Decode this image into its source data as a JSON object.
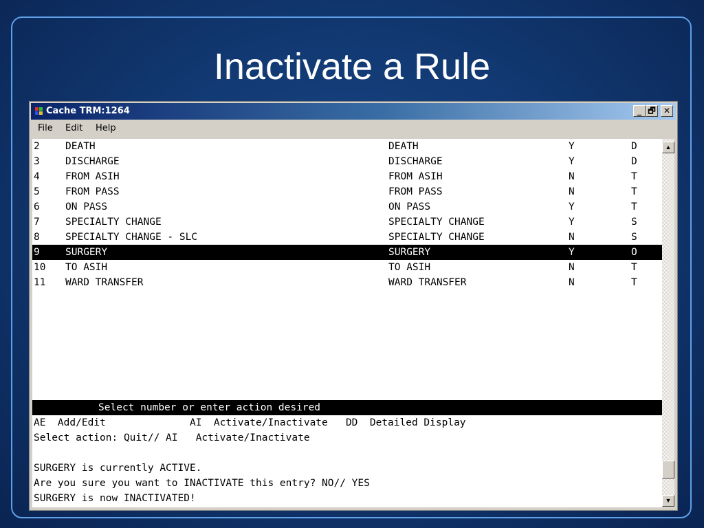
{
  "slide": {
    "title": "Inactivate a Rule"
  },
  "window": {
    "title": "Cache TRM:1264",
    "controls": {
      "minimize": "_",
      "restore": "🗗",
      "close": "✕"
    }
  },
  "menu": [
    "File",
    "Edit",
    "Help"
  ],
  "rows": [
    {
      "num": "2",
      "name": "DEATH",
      "type": "DEATH",
      "flag": "Y",
      "code": "D"
    },
    {
      "num": "3",
      "name": "DISCHARGE",
      "type": "DISCHARGE",
      "flag": "Y",
      "code": "D"
    },
    {
      "num": "4",
      "name": "FROM ASIH",
      "type": "FROM ASIH",
      "flag": "N",
      "code": "T"
    },
    {
      "num": "5",
      "name": "FROM PASS",
      "type": "FROM PASS",
      "flag": "N",
      "code": "T"
    },
    {
      "num": "6",
      "name": "ON PASS",
      "type": "ON PASS",
      "flag": "Y",
      "code": "T"
    },
    {
      "num": "7",
      "name": "SPECIALTY CHANGE",
      "type": "SPECIALTY CHANGE",
      "flag": "Y",
      "code": "S"
    },
    {
      "num": "8",
      "name": "SPECIALTY CHANGE - SLC",
      "type": "SPECIALTY CHANGE",
      "flag": "N",
      "code": "S"
    },
    {
      "num": "9",
      "name": "SURGERY",
      "type": "SURGERY",
      "flag": "Y",
      "code": "O"
    },
    {
      "num": "10",
      "name": "TO ASIH",
      "type": "TO ASIH",
      "flag": "N",
      "code": "T"
    },
    {
      "num": "11",
      "name": "WARD TRANSFER",
      "type": "WARD TRANSFER",
      "flag": "N",
      "code": "T"
    }
  ],
  "prompt_bar": "           Select number or enter action desired",
  "actions_line": "AE  Add/Edit              AI  Activate/Inactivate   DD  Detailed Display",
  "console": [
    "Select action: Quit// AI   Activate/Inactivate",
    "",
    "SURGERY is currently ACTIVE.",
    "Are you sure you want to INACTIVATE this entry? NO// YES",
    "SURGERY is now INACTIVATED!"
  ],
  "scroll": {
    "up": "▲",
    "down": "▼"
  }
}
